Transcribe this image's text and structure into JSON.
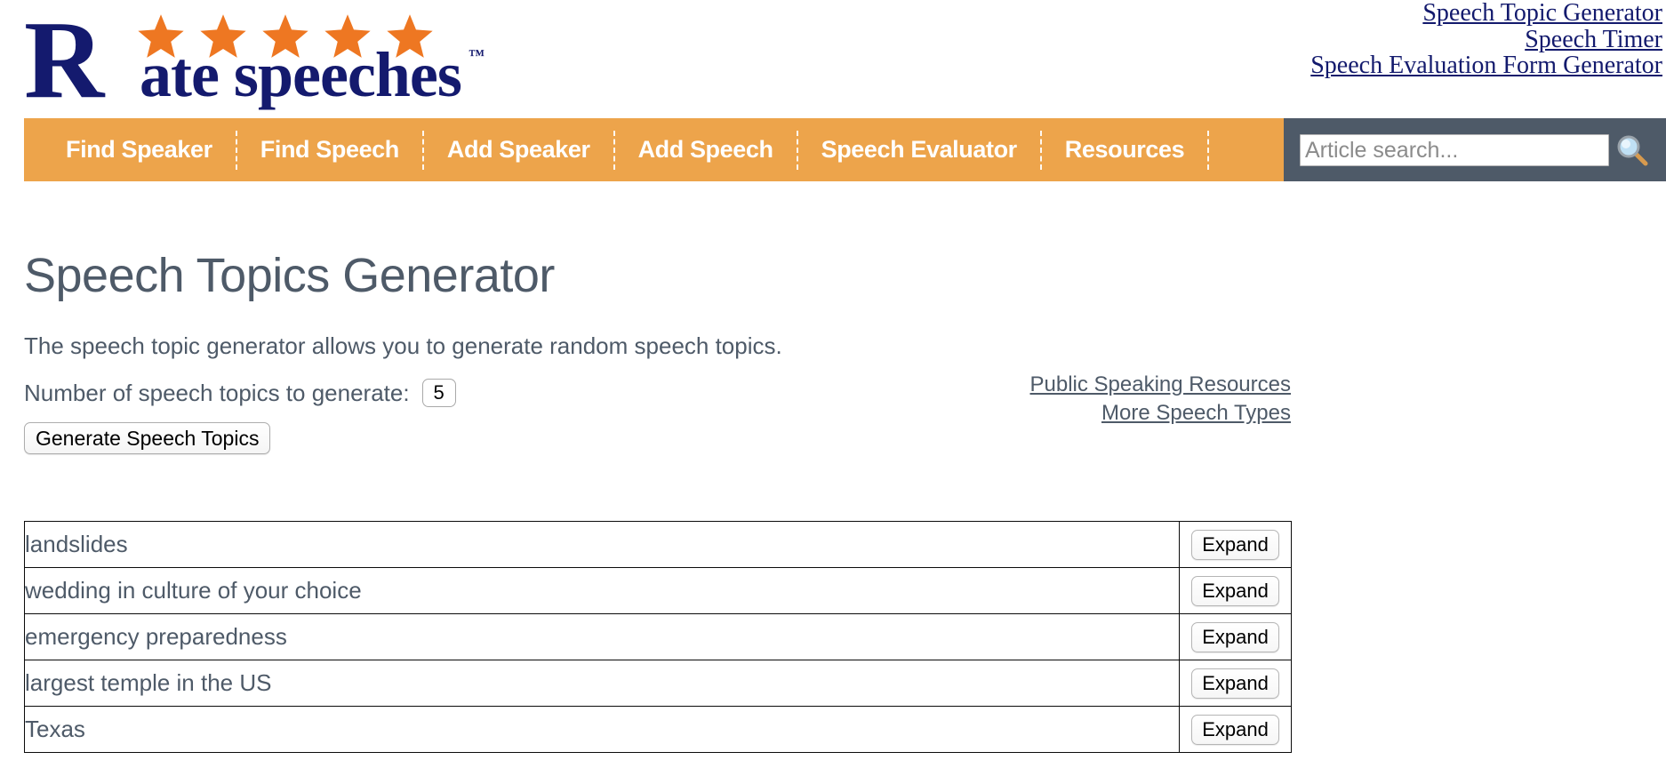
{
  "brand": {
    "logo_letter": "R",
    "logo_word": "ate speeches",
    "logo_tm": "™",
    "star_count": 5,
    "navy": "#141a6e",
    "orange": "#ee7722"
  },
  "header_links": [
    {
      "label": "Speech Topic Generator"
    },
    {
      "label": "Speech Timer"
    },
    {
      "label": "Speech Evaluation Form Generator"
    }
  ],
  "nav": {
    "background": "#eda44b",
    "search_background": "#4e5a68",
    "items": [
      {
        "label": "Find Speaker"
      },
      {
        "label": "Find Speech"
      },
      {
        "label": "Add Speaker"
      },
      {
        "label": "Add Speech"
      },
      {
        "label": "Speech Evaluator"
      },
      {
        "label": "Resources"
      }
    ],
    "search": {
      "placeholder": "Article search...",
      "value": "",
      "icon": "search-icon"
    }
  },
  "main": {
    "title": "Speech Topics Generator",
    "intro": "The speech topic generator allows you to generate random speech topics.",
    "count_label": "Number of speech topics to generate:",
    "count_value": "5",
    "generate_label": "Generate Speech Topics",
    "title_color": "#4e5a68"
  },
  "side_links": [
    {
      "label": "Public Speaking Resources"
    },
    {
      "label": "More Speech Types"
    }
  ],
  "topics": {
    "expand_label": "Expand",
    "rows": [
      {
        "topic": "landslides"
      },
      {
        "topic": "wedding in culture of your choice"
      },
      {
        "topic": "emergency preparedness"
      },
      {
        "topic": "largest temple in the US"
      },
      {
        "topic": "Texas"
      }
    ]
  }
}
